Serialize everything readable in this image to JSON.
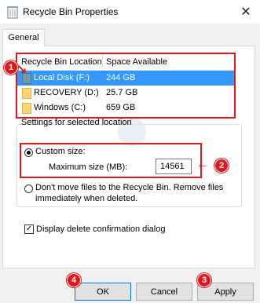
{
  "window": {
    "title": "Recycle Bin Properties",
    "close_glyph": "✕"
  },
  "tabs": [
    {
      "label": "General"
    }
  ],
  "list": {
    "columns": [
      "Recycle Bin Location",
      "Space Available"
    ],
    "rows": [
      {
        "name": "Local Disk (F:)",
        "space": "244 GB",
        "selected": true
      },
      {
        "name": "RECOVERY (D:)",
        "space": "25.7 GB",
        "selected": false
      },
      {
        "name": "Windows (C:)",
        "space": "659 GB",
        "selected": false
      }
    ]
  },
  "settings": {
    "group_label": "Settings for selected location",
    "custom_size_label": "Custom size:",
    "max_size_label": "Maximum size (MB):",
    "max_size_value": "14561",
    "dont_move_line1": "Don't move files to the Recycle Bin. Remove files",
    "dont_move_line2": "immediately when deleted.",
    "display_confirm_label": "Display delete confirmation dialog",
    "display_confirm_checked": true,
    "check_glyph": "✓"
  },
  "buttons": {
    "ok": "OK",
    "cancel": "Cancel",
    "apply": "Apply"
  },
  "annotations": {
    "badge_1": "1",
    "badge_2": "2",
    "badge_3": "3",
    "badge_4": "4",
    "accent_color": "#e3161c",
    "arrow_glyph": "←"
  },
  "colors": {
    "selection": "#3399ff",
    "default_button_border": "#0078d7"
  }
}
